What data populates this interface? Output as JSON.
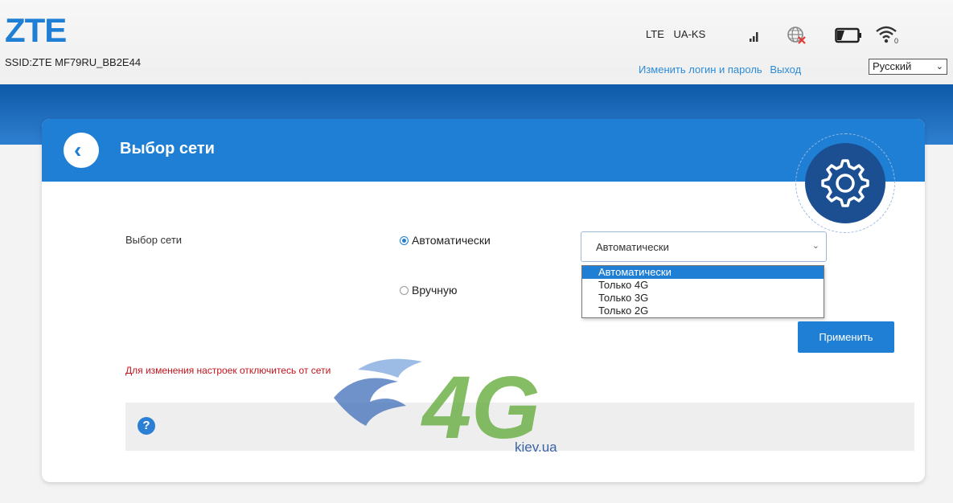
{
  "header": {
    "logo": "ZTE",
    "ssid": "SSID:ZTE MF79RU_BB2E44",
    "network_type": "LTE",
    "operator": "UA-KS",
    "icons": [
      "signal-icon",
      "globe-disconnected-icon",
      "battery-icon",
      "wifi-icon"
    ],
    "change_login_link": "Изменить логин и пароль",
    "logout_link": "Выход",
    "language": "Русский"
  },
  "page": {
    "title": "Выбор сети",
    "field_label": "Выбор сети",
    "radio_auto": "Автоматически",
    "radio_manual": "Вручную",
    "selected_radio": "auto",
    "select_value": "Автоматически",
    "options": [
      "Автоматически",
      "Только 4G",
      "Только 3G",
      "Только 2G"
    ],
    "apply_button": "Применить",
    "warning": "Для изменения настроек отключитесь от сети",
    "help": "?"
  },
  "watermark": {
    "text": "kiev.ua"
  },
  "colors": {
    "brand": "#1f7fd4",
    "header_band": "#0e5aa8",
    "warning": "#c0141c"
  }
}
